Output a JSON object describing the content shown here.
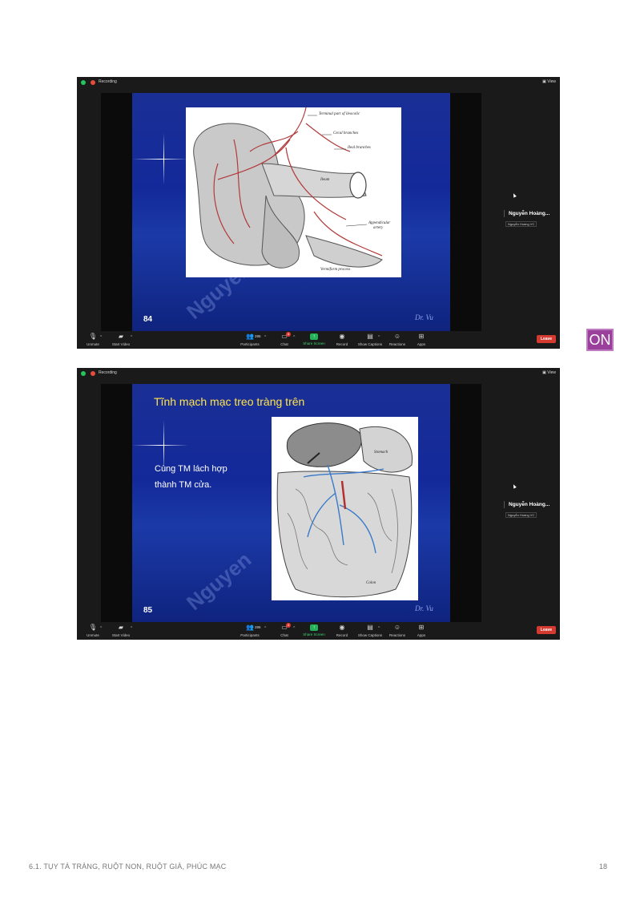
{
  "screenshots": [
    {
      "recording_label": "Recording",
      "view_label": "View",
      "slide_number": "84",
      "slide_title": "",
      "slide_text": [],
      "signature": "Dr. Vu",
      "watermark": "Nguyen",
      "figure_labels": [
        "Terminal part of ileocolic",
        "Cecal branches",
        "Ileal branches",
        "Ileum",
        "Appendicular",
        "artery",
        "Vermiform process"
      ],
      "participant_name": "Nguyễn Hoàng...",
      "participant_chip": "Nguyễn Hoàng VC",
      "participants_count": "286",
      "chat_badge": "4"
    },
    {
      "recording_label": "Recording",
      "view_label": "View",
      "slide_number": "85",
      "slide_title": "Tĩnh mạch mạc treo tràng trên",
      "slide_text": [
        "Cùng TM lách hợp",
        "thành TM cửa."
      ],
      "signature": "Dr. Vu",
      "watermark": "Nguyen",
      "figure_labels": [
        "Stomach",
        "Colon"
      ],
      "participant_name": "Nguyễn Hoàng...",
      "participant_chip": "Nguyễn Hoàng VC",
      "participants_count": "286",
      "chat_badge": "4"
    }
  ],
  "toolbar": {
    "unmute": "Unmute",
    "start_video": "Start Video",
    "participants": "Participants",
    "chat": "Chat",
    "share_screen": "Share Screen",
    "record": "Record",
    "show_captions": "Show Captions",
    "reactions": "Reactions",
    "apps": "Apps",
    "leave": "Leave"
  },
  "on_badge": "ON",
  "footer": {
    "chapter": "6.1. TỤY TÁ TRÀNG, RUỘT NON, RUỘT GIÀ, PHÚC MẠC",
    "page": "18"
  },
  "colors": {
    "slide_blue": "#13299a",
    "title_yellow": "#ffe44a",
    "leave_red": "#d43a2f",
    "share_green": "#22b35a",
    "on_badge_purple": "#9b3f9c"
  }
}
